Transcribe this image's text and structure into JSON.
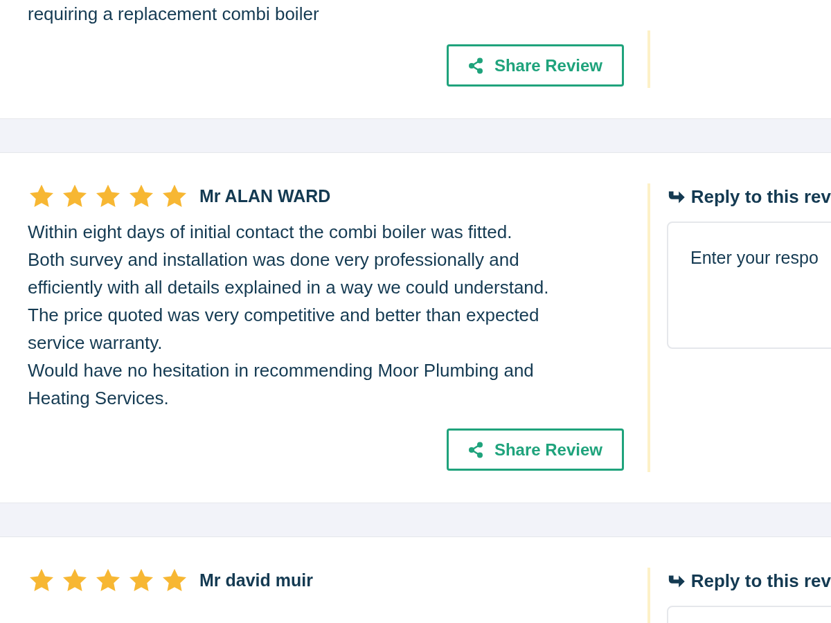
{
  "reviews": [
    {
      "text": "requiring a replacement combi boiler",
      "share_button": "Share Review"
    },
    {
      "stars": 5,
      "name": "Mr ALAN WARD",
      "text": " Within eight days of initial contact the combi boiler was fitted.\nBoth survey and installation was done very professionally and efficiently with all details explained in a way we could understand.\nThe price quoted was very competitive and better than expected service warranty.\nWould have no hesitation in recommending Moor Plumbing and Heating Services.",
      "share_button": "Share Review",
      "reply": {
        "title": "Reply to this rev",
        "placeholder": "Enter your respo"
      }
    },
    {
      "stars": 5,
      "name": "Mr david muir",
      "reply": {
        "title": "Reply to this rev"
      }
    }
  ]
}
